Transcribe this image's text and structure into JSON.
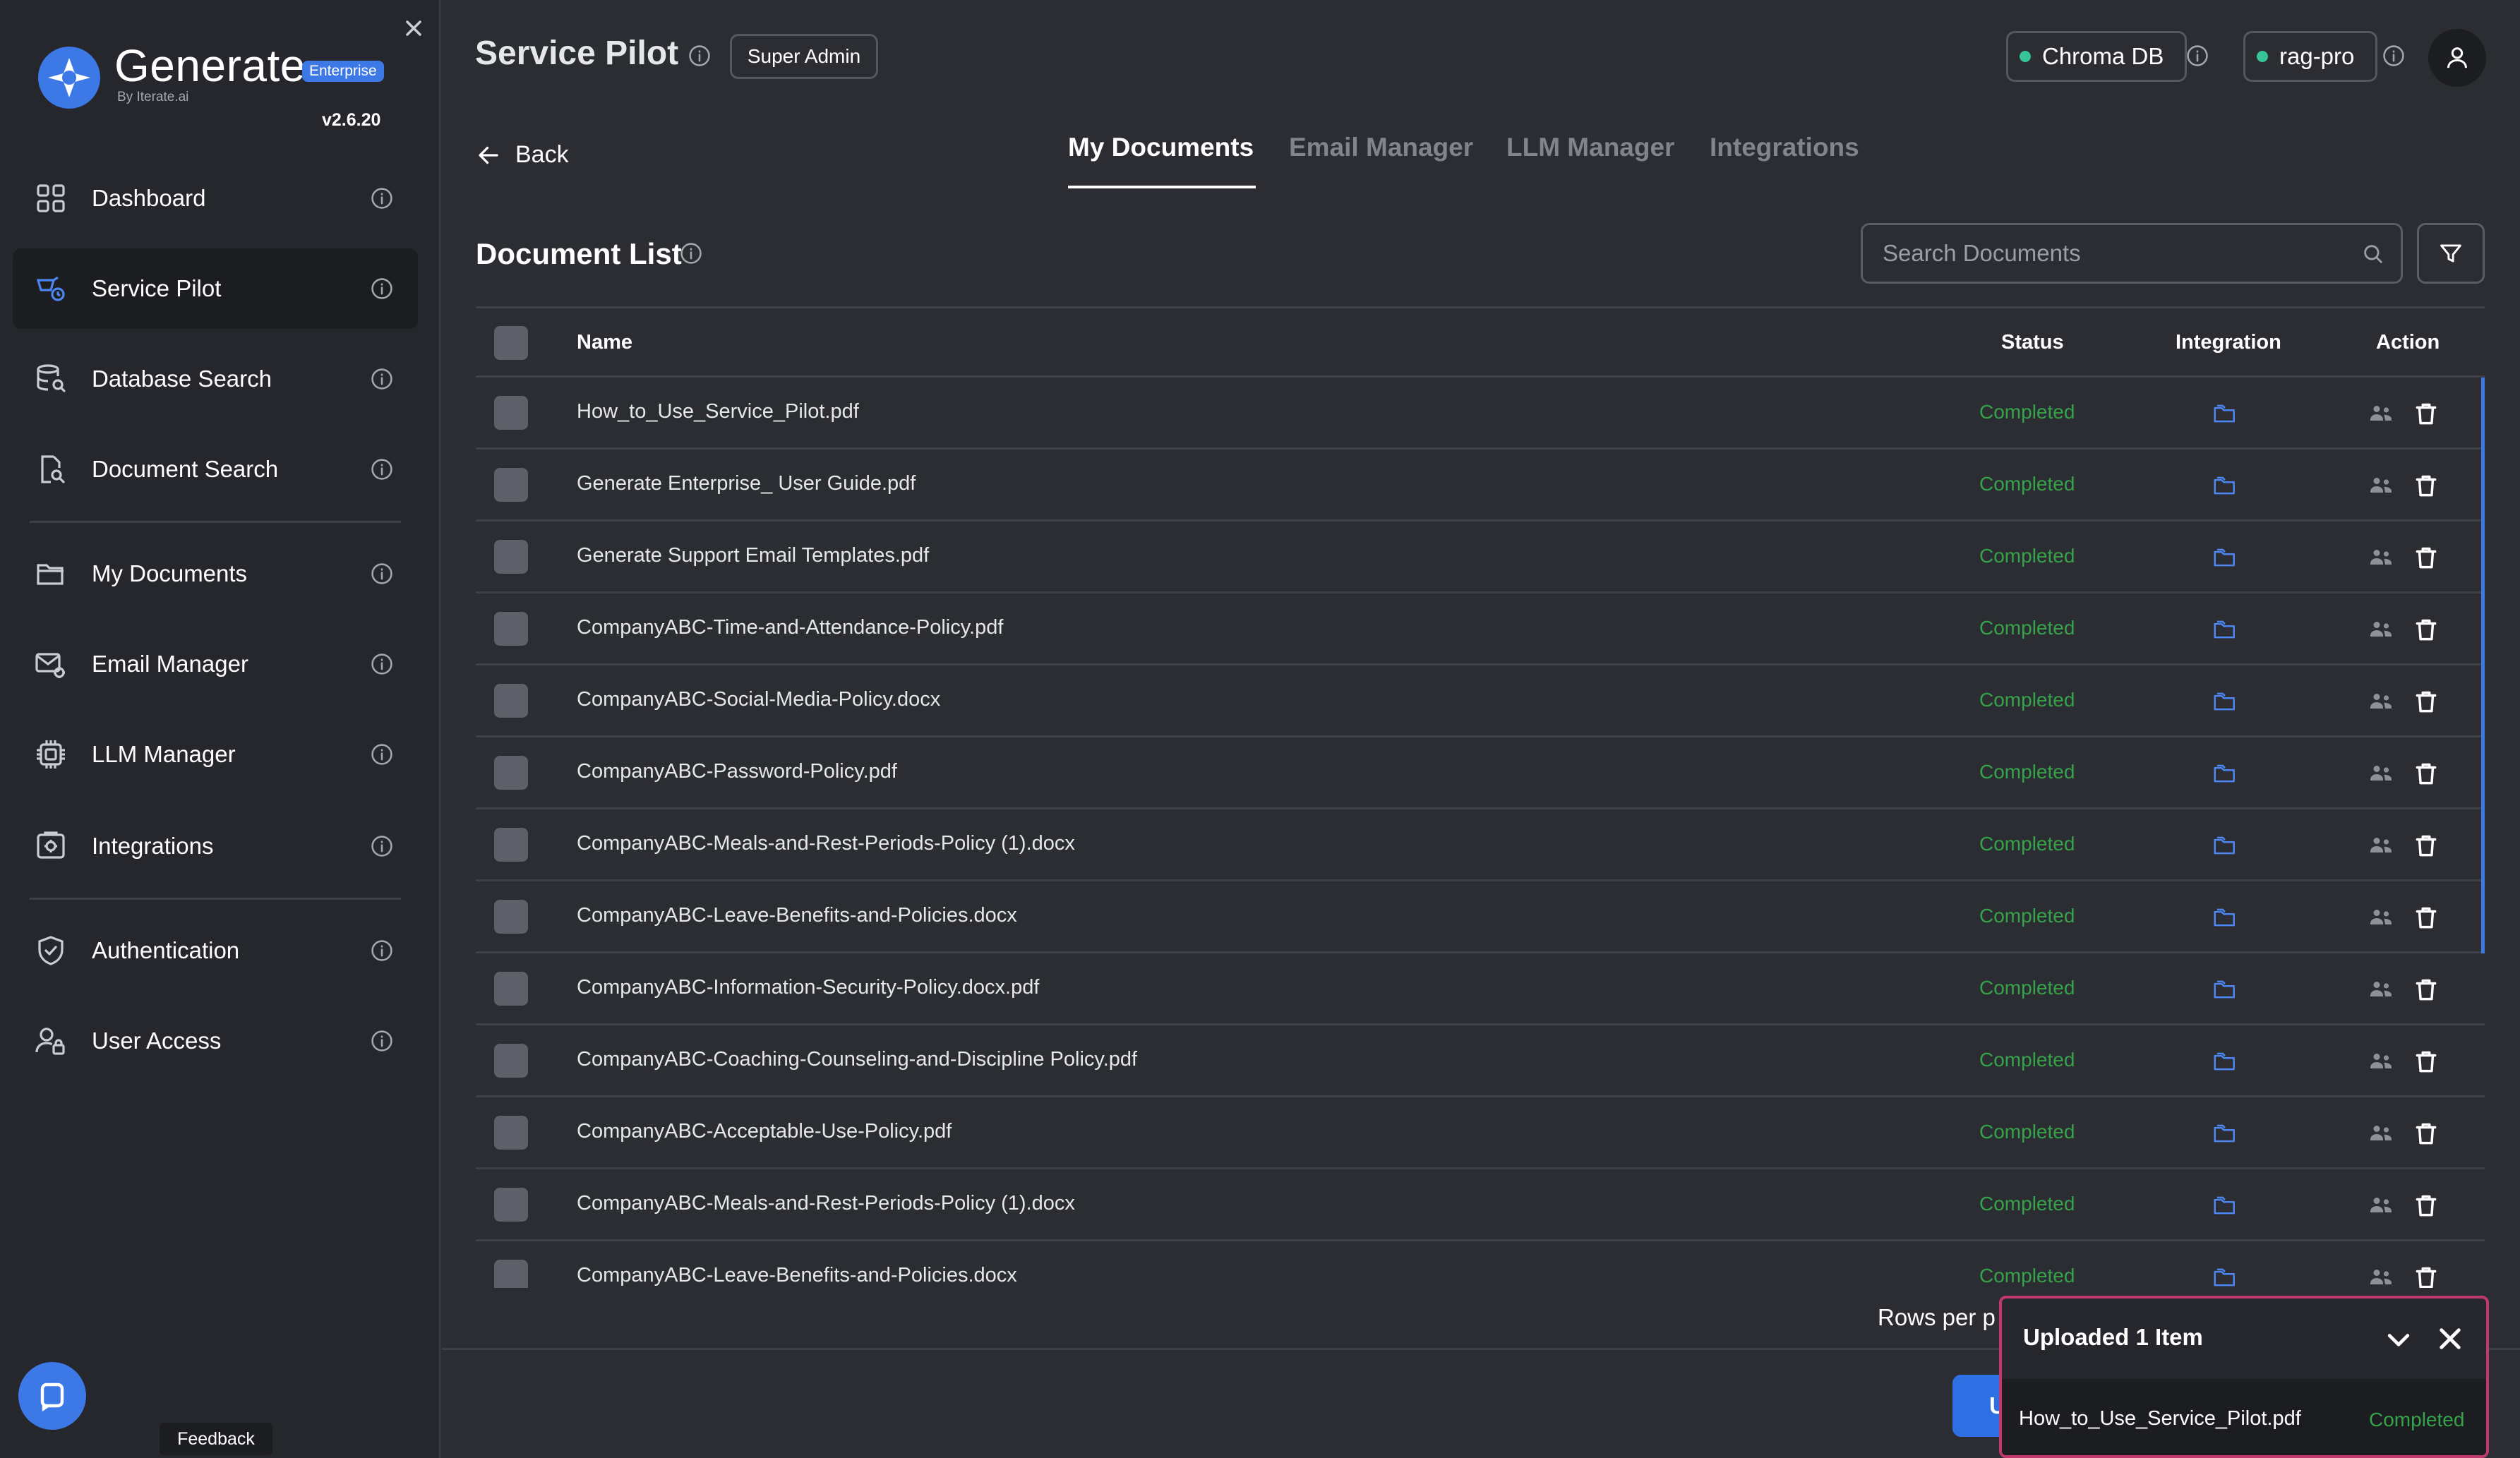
{
  "brand": {
    "name": "Generate",
    "badge": "Enterprise",
    "by": "By Iterate.ai",
    "version": "v2.6.20"
  },
  "sidebar": {
    "items": [
      {
        "label": "Dashboard",
        "icon": "grid-icon"
      },
      {
        "label": "Service Pilot",
        "icon": "service-pilot-icon",
        "active": true
      },
      {
        "label": "Database Search",
        "icon": "database-search-icon"
      },
      {
        "label": "Document Search",
        "icon": "document-search-icon"
      },
      {
        "label": "My Documents",
        "icon": "folder-icon"
      },
      {
        "label": "Email Manager",
        "icon": "email-gear-icon"
      },
      {
        "label": "LLM Manager",
        "icon": "chip-icon"
      },
      {
        "label": "Integrations",
        "icon": "integrations-icon"
      },
      {
        "label": "Authentication",
        "icon": "shield-check-icon"
      },
      {
        "label": "User Access",
        "icon": "user-lock-icon"
      }
    ],
    "feedback": "Feedback"
  },
  "header": {
    "title": "Service Pilot",
    "role": "Super Admin",
    "db_status": "Chroma DB",
    "model_status": "rag-pro"
  },
  "nav": {
    "back": "Back",
    "tabs": [
      "My Documents",
      "Email Manager",
      "LLM Manager",
      "Integrations"
    ],
    "active_tab": "My Documents"
  },
  "documents": {
    "title": "Document List",
    "search_placeholder": "Search Documents",
    "columns": {
      "name": "Name",
      "status": "Status",
      "integration": "Integration",
      "action": "Action"
    },
    "rows": [
      {
        "name": "How_to_Use_Service_Pilot.pdf",
        "status": "Completed"
      },
      {
        "name": "Generate Enterprise_ User Guide.pdf",
        "status": "Completed"
      },
      {
        "name": "Generate Support Email Templates.pdf",
        "status": "Completed"
      },
      {
        "name": "CompanyABC-Time-and-Attendance-Policy.pdf",
        "status": "Completed"
      },
      {
        "name": "CompanyABC-Social-Media-Policy.docx",
        "status": "Completed"
      },
      {
        "name": "CompanyABC-Password-Policy.pdf",
        "status": "Completed"
      },
      {
        "name": "CompanyABC-Meals-and-Rest-Periods-Policy (1).docx",
        "status": "Completed"
      },
      {
        "name": "CompanyABC-Leave-Benefits-and-Policies.docx",
        "status": "Completed"
      },
      {
        "name": "CompanyABC-Information-Security-Policy.docx.pdf",
        "status": "Completed"
      },
      {
        "name": "CompanyABC-Coaching-Counseling-and-Discipline Policy.pdf",
        "status": "Completed"
      },
      {
        "name": "CompanyABC-Acceptable-Use-Policy.pdf",
        "status": "Completed"
      },
      {
        "name": "CompanyABC-Meals-and-Rest-Periods-Policy (1).docx",
        "status": "Completed"
      },
      {
        "name": "CompanyABC-Leave-Benefits-and-Policies.docx",
        "status": "Completed"
      }
    ],
    "rows_per_page_label": "Rows per p",
    "upload_button_label": "U"
  },
  "upload_toast": {
    "title": "Uploaded 1 Item",
    "file": "How_to_Use_Service_Pilot.pdf",
    "status": "Completed"
  },
  "colors": {
    "accent": "#3c78e6",
    "success": "#36a24a",
    "status_dot": "#36c496",
    "toast_border": "#c0396e"
  }
}
